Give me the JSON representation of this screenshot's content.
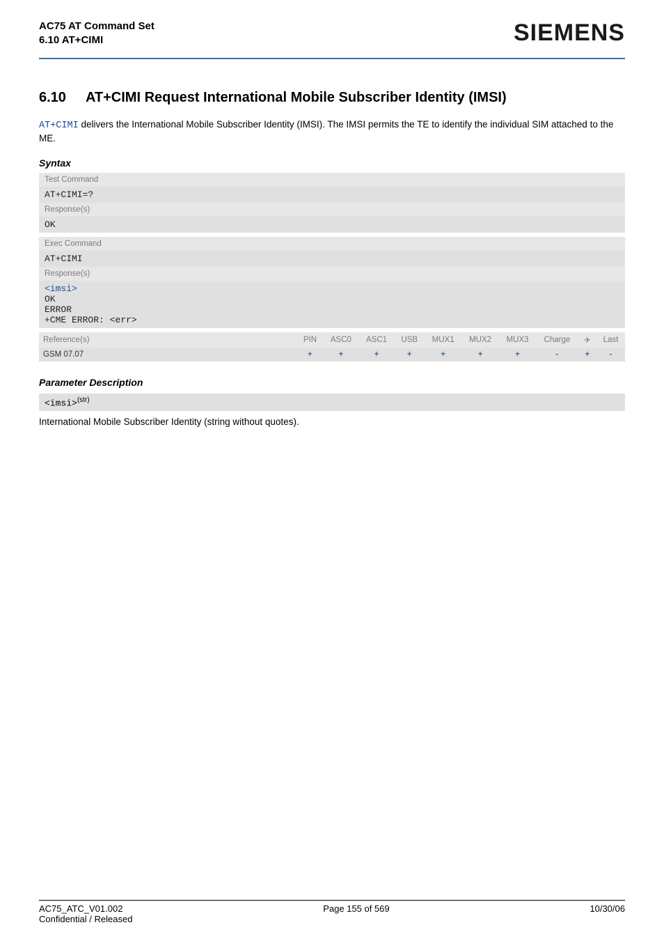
{
  "header": {
    "doc_title": "AC75 AT Command Set",
    "section_ref": "6.10 AT+CIMI",
    "brand": "SIEMENS"
  },
  "section": {
    "number": "6.10",
    "title": "AT+CIMI   Request International Mobile Subscriber Identity (IMSI)"
  },
  "intro": {
    "cmd": "AT+CIMI",
    "rest": " delivers the International Mobile Subscriber Identity (IMSI). The IMSI permits the TE to identify the individual SIM attached to the ME."
  },
  "syntax_label": "Syntax",
  "test_block": {
    "label": "Test Command",
    "cmd": "AT+CIMI=?",
    "resp_label": "Response(s)",
    "resp": "OK"
  },
  "exec_block": {
    "label": "Exec Command",
    "cmd": "AT+CIMI",
    "resp_label": "Response(s)",
    "resp_line1": "<imsi>",
    "resp_line2": "OK",
    "resp_line3": "ERROR",
    "resp_line4": "+CME ERROR: <err>"
  },
  "ref": {
    "label": "Reference(s)",
    "cols": [
      "PIN",
      "ASC0",
      "ASC1",
      "USB",
      "MUX1",
      "MUX2",
      "MUX3",
      "Charge",
      "✈",
      "Last"
    ],
    "body_label": "GSM 07.07",
    "vals": [
      "+",
      "+",
      "+",
      "+",
      "+",
      "+",
      "+",
      "-",
      "+",
      "-"
    ]
  },
  "param_label": "Parameter Description",
  "param_box": "<imsi>",
  "param_sup": "(str)",
  "param_desc": "International Mobile Subscriber Identity (string without quotes).",
  "footer": {
    "left": "AC75_ATC_V01.002",
    "center": "Page 155 of 569",
    "right": "10/30/06",
    "left2": "Confidential / Released"
  }
}
